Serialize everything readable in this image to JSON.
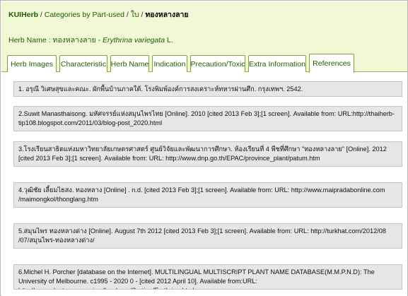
{
  "breadcrumb": {
    "home": "KUIHerb",
    "sep1": " / ",
    "category": "Categories by Part-used",
    "sep2": " / ",
    "part": "ใบ",
    "sep3": " / ",
    "current": "ทองหลางลาย"
  },
  "herb": {
    "label": "Herb Name : ทองหลางลาย - ",
    "scientific": "Erythrina variegata",
    "author": " L."
  },
  "tabs": [
    {
      "label": "Herb Images"
    },
    {
      "label": "Characteristic"
    },
    {
      "label": "Herb Name"
    },
    {
      "label": "Indication"
    },
    {
      "label": "Precaution/Toxic"
    },
    {
      "label": "Extra Information"
    },
    {
      "label": "References"
    }
  ],
  "active_tab": "References",
  "references": [
    "1. อรุณี วิเศษสุขและคณะ. ผักพื้นบ้านภาคใต้. โรงพิมพ์องค์การสงเคราะห์ทหารผ่านศึก. กรุงเทพฯ. 2542.",
    "2.Suwit Manasthaisong. มหัศจรรย์แห่งสมุนไพรไทย [Online]. 2010 [cited 2013 Feb 3];[1 screen]. Available from: URL:http://thaiherb-tip108.blogspot.com/2011/03/blog-post_2020.html",
    "3.โรงเรียนสาธิตแห่งมหาวิทยาลัยเกษตรศาสตร์ ศูนย์วิจัยและพัฒนาการศึกษา. ห้องเรียนที่ 4 พืชที่ศึกษา \"ทองหลางลาย\" [Online]. 2012 [cited 2013 Feb 3];[1 screen]. Available from: URL: http://www.dnp.go.th/EPAC/province_plant/patum.htm",
    "4.วุฒิชัย เลี้ยมไธสง. ทองหลาง [Online] . n.d. [cited 2013 Feb 3];[1 screen]. Available from: URL: http://www.maipradabonline.com /maimongkol/thonglang.htm",
    "5.สมุนไพร ทองหลางด่าง [Online]. August 7th 2012 [cited 2013 Feb 3];[1 screen]. Available from: URL: http://turkhat.com/2012/08 /07/สมุนไพร-ทองหลางด่าง/",
    "6.Michel H. Porcher [database on the Internet]. MULTILINGUAL MULTISCRIPT PLANT NAME DATABASE(M.M.P.N.D): The University of Melbourne. c1995 - 2020 0 - [cited 2012 April 10]. Available from:URL: http://www.plantnames.unimelb.edu.au/Sorting/Erythrina.html"
  ],
  "colors": {
    "header_bg": "#f2f7d6",
    "link_green": "#1a5f00",
    "tab_border": "#7ea23a",
    "ref_bg": "#e6e6e6"
  }
}
